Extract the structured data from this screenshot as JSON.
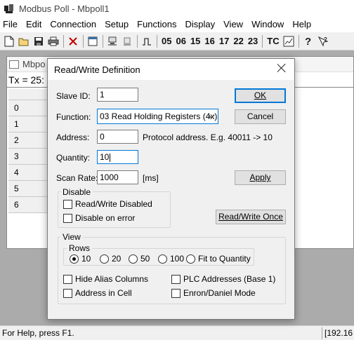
{
  "window": {
    "title": "Modbus Poll - Mbpoll1"
  },
  "menu": [
    "File",
    "Edit",
    "Connection",
    "Setup",
    "Functions",
    "Display",
    "View",
    "Window",
    "Help"
  ],
  "toolbar": {
    "function_codes": [
      "05",
      "06",
      "15",
      "16",
      "17",
      "22",
      "23"
    ],
    "tc_label": "TC"
  },
  "child": {
    "title": "Mbpo",
    "tx_text": "Tx = 25:",
    "row_numbers": [
      "0",
      "1",
      "2",
      "3",
      "4",
      "5",
      "6"
    ]
  },
  "dialog": {
    "title": "Read/Write Definition",
    "slave_id": {
      "label": "Slave ID:",
      "value": "1"
    },
    "function": {
      "label": "Function:",
      "value": "03 Read Holding Registers (4x)"
    },
    "address": {
      "label": "Address:",
      "value": "0",
      "hint": "Protocol address. E.g. 40011 -> 10"
    },
    "quantity": {
      "label": "Quantity:",
      "value": "10"
    },
    "scan_rate": {
      "label": "Scan Rate:",
      "value": "1000",
      "unit": "[ms]"
    },
    "buttons": {
      "ok": "OK",
      "cancel": "Cancel",
      "apply": "Apply",
      "read_write_once": "Read/Write Once"
    },
    "disable_group": {
      "legend": "Disable",
      "rw_disabled": "Read/Write Disabled",
      "disable_on_error": "Disable on error"
    },
    "view_group": {
      "legend": "View",
      "rows_legend": "Rows",
      "rows_options": [
        "10",
        "20",
        "50",
        "100",
        "Fit to Quantity"
      ],
      "rows_selected": "10",
      "hide_alias": "Hide Alias Columns",
      "address_in_cell": "Address in Cell",
      "plc_addresses": "PLC Addresses (Base 1)",
      "enron_mode": "Enron/Daniel Mode"
    }
  },
  "status": {
    "help": "For Help, press F1.",
    "connection": "[192.16"
  }
}
